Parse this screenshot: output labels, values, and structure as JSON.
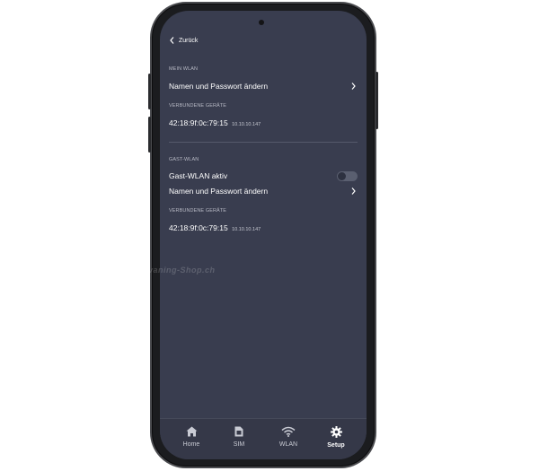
{
  "header": {
    "back_label": "Zurück"
  },
  "mein_wlan": {
    "section_label": "MEIN WLAN",
    "change_label": "Namen und Passwort ändern",
    "devices_label": "VERBUNDENE GERÄTE",
    "devices": [
      {
        "mac": "42:18:9f:0c:79:15",
        "ip": "10.10.10.147"
      }
    ]
  },
  "gast_wlan": {
    "section_label": "GAST-WLAN",
    "toggle_label": "Gast-WLAN aktiv",
    "toggle_on": false,
    "change_label": "Namen und Passwort ändern",
    "devices_label": "VERBUNDENE GERÄTE",
    "devices": [
      {
        "mac": "42:18:9f:0c:79:15",
        "ip": "10.10.10.147"
      }
    ]
  },
  "watermark": "Caravaning-Shop.ch",
  "nav": {
    "items": [
      {
        "label": "Home",
        "icon": "home-icon"
      },
      {
        "label": "SIM",
        "icon": "sim-icon"
      },
      {
        "label": "WLAN",
        "icon": "wifi-icon"
      },
      {
        "label": "Setup",
        "icon": "gear-icon"
      }
    ],
    "active": "Setup"
  },
  "colors": {
    "screen_bg": "#393d4f",
    "navbar_bg": "#353848",
    "text": "#ffffff",
    "muted": "#b7b9c4"
  }
}
